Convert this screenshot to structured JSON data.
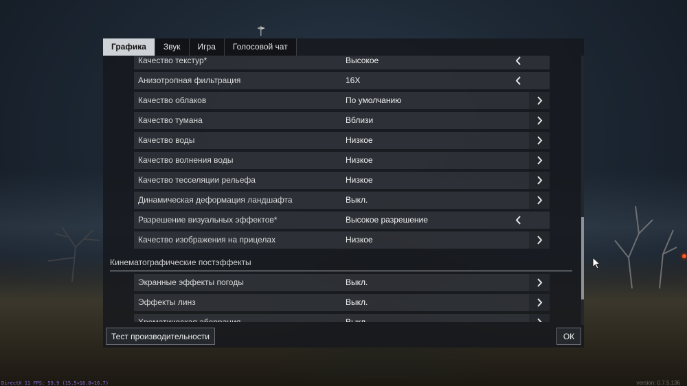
{
  "tabs": [
    {
      "label": "Графика",
      "active": true
    },
    {
      "label": "Звук",
      "active": false
    },
    {
      "label": "Игра",
      "active": false
    },
    {
      "label": "Голосовой чат",
      "active": false
    }
  ],
  "settings_rows": [
    {
      "label": "Качество текстур*",
      "value": "Высокое",
      "arrow": "left-arrow-icon"
    },
    {
      "label": "Анизотропная фильтрация",
      "value": "16X",
      "arrow": "left-arrow-icon"
    },
    {
      "label": "Качество облаков",
      "value": "По умолчанию",
      "arrow": "right-arrow-icon"
    },
    {
      "label": "Качество тумана",
      "value": "Вблизи",
      "arrow": "right-arrow-icon"
    },
    {
      "label": "Качество воды",
      "value": "Низкое",
      "arrow": "right-arrow-icon"
    },
    {
      "label": "Качество волнения воды",
      "value": "Низкое",
      "arrow": "right-arrow-icon"
    },
    {
      "label": "Качество тесселяции рельефа",
      "value": "Низкое",
      "arrow": "right-arrow-icon"
    },
    {
      "label": "Динамическая деформация ландшафта",
      "value": "Выкл.",
      "arrow": "right-arrow-icon"
    },
    {
      "label": "Разрешение визуальных эффектов*",
      "value": "Высокое разрешение",
      "arrow": "left-arrow-icon"
    },
    {
      "label": "Качество изображения на прицелах",
      "value": "Низкое",
      "arrow": "right-arrow-icon"
    }
  ],
  "section": {
    "title": "Кинематографические постэффекты"
  },
  "section_rows": [
    {
      "label": "Экранные эффекты погоды",
      "value": "Выкл.",
      "arrow": "right-arrow-icon"
    },
    {
      "label": "Эффекты линз",
      "value": "Выкл.",
      "arrow": "right-arrow-icon"
    },
    {
      "label": "Хроматическая аберрация",
      "value": "Выкл.",
      "arrow": "right-arrow-icon"
    }
  ],
  "buttons": {
    "performance_test": "Тест производительности",
    "ok": "ОК"
  },
  "footer": {
    "stats": "DirectX 11 FPS: 59.9 (15.5<16.8<16.7)",
    "version": "version: 0.7.5.136"
  },
  "colors": {
    "active_tab_bg": "#cfd2d6",
    "row_bg": "#3a3e44",
    "dialog_bg": "#16191d"
  }
}
